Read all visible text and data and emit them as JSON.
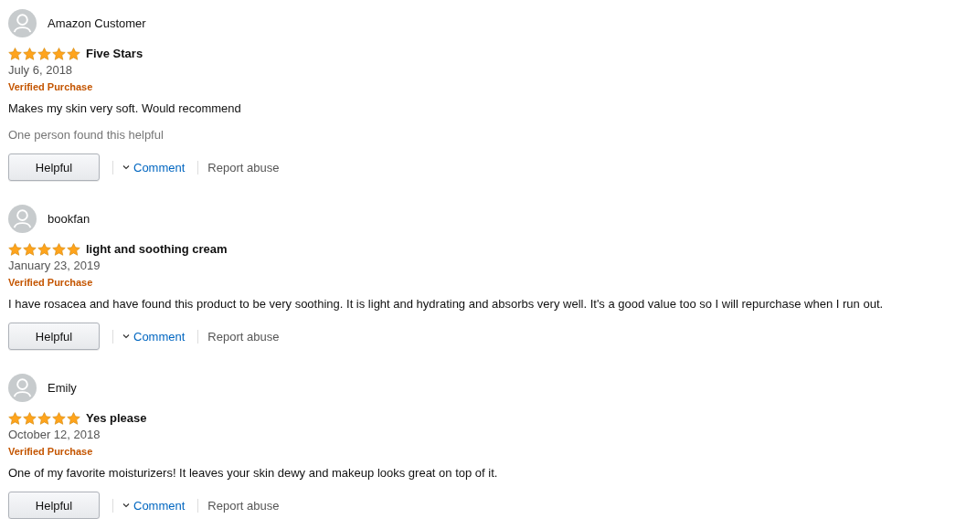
{
  "reviews": [
    {
      "author": "Amazon Customer",
      "stars": 5,
      "title": "Five Stars",
      "date": "July 6, 2018",
      "badge": "Verified Purchase",
      "body": "Makes my skin very soft. Would recommend",
      "helpful_count": "One person found this helpful",
      "helpful_button": "Helpful",
      "comment_link": "Comment",
      "report_link": "Report abuse"
    },
    {
      "author": "bookfan",
      "stars": 5,
      "title": "light and soothing cream",
      "date": "January 23, 2019",
      "badge": "Verified Purchase",
      "body": "I have rosacea and have found this product to be very soothing. It is light and hydrating and absorbs very well. It's a good value too so I will repurchase when I run out.",
      "helpful_button": "Helpful",
      "comment_link": "Comment",
      "report_link": "Report abuse"
    },
    {
      "author": "Emily",
      "stars": 5,
      "title": "Yes please",
      "date": "October 12, 2018",
      "badge": "Verified Purchase",
      "body": "One of my favorite moisturizers! It leaves your skin dewy and makeup looks great on top of it.",
      "helpful_button": "Helpful",
      "comment_link": "Comment",
      "report_link": "Report abuse"
    }
  ]
}
